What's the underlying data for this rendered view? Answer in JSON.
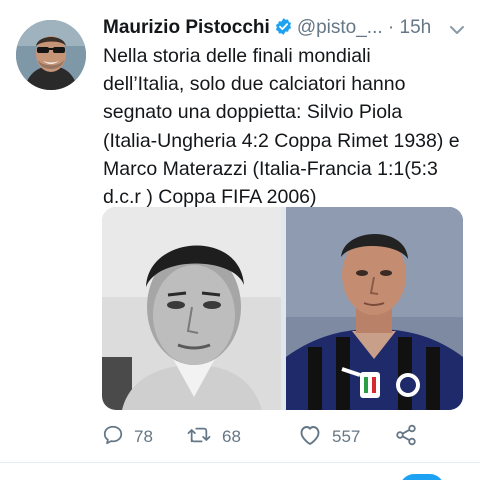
{
  "tweet": {
    "author": {
      "display_name": "Maurizio Pistocchi",
      "handle": "@pisto_...",
      "verified": true
    },
    "separator": "·",
    "timestamp": "15h",
    "text": "Nella storia delle finali mondiali\ndell’Italia, solo due calciatori hanno\nsegnato una doppietta: Silvio Piola\n(Italia-Ungheria 4:2 Coppa Rimet 1938) e\nMarco Materazzi (Italia-Francia 1:1(5:3\nd.c.r ) Coppa FIFA 2006)",
    "media": [
      {
        "kind": "photo"
      },
      {
        "kind": "photo"
      }
    ],
    "actions": {
      "reply_count": "78",
      "retweet_count": "68",
      "like_count": "557"
    }
  },
  "icons": {
    "verified": "verified-badge-icon",
    "more": "chevron-down-icon",
    "reply": "reply-icon",
    "retweet": "retweet-icon",
    "like": "heart-icon",
    "share": "share-icon"
  },
  "colors": {
    "accent": "#1da1f2",
    "text_primary": "#14171a",
    "text_secondary": "#657786",
    "divider": "#e6ecf0"
  }
}
